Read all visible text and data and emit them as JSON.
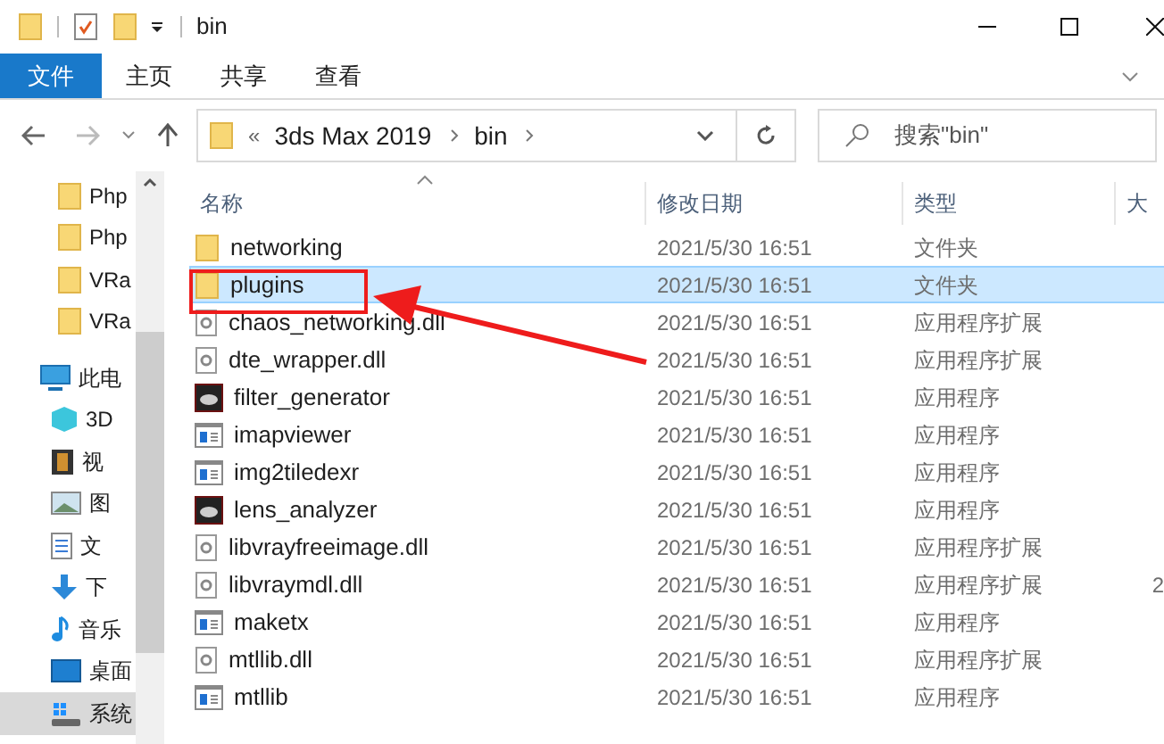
{
  "window": {
    "title": "bin"
  },
  "ribbon_tabs": [
    {
      "label": "文件",
      "selected": true
    },
    {
      "label": "主页",
      "selected": false
    },
    {
      "label": "共享",
      "selected": false
    },
    {
      "label": "查看",
      "selected": false
    }
  ],
  "address": {
    "overflow": "«",
    "path": [
      "3ds Max 2019",
      "bin"
    ]
  },
  "search": {
    "placeholder": "搜索\"bin\""
  },
  "sidebar": {
    "items": [
      {
        "label": "Php",
        "kind": "folder",
        "selected": false
      },
      {
        "label": "Php",
        "kind": "folder",
        "selected": false
      },
      {
        "label": "VRa",
        "kind": "folder",
        "selected": false
      },
      {
        "label": "VRa",
        "kind": "folder",
        "selected": false
      },
      {
        "label": "此电",
        "kind": "pc",
        "selected": false
      },
      {
        "label": "3D",
        "kind": "cube",
        "selected": false
      },
      {
        "label": "视",
        "kind": "video",
        "selected": false
      },
      {
        "label": "图",
        "kind": "image",
        "selected": false
      },
      {
        "label": "文",
        "kind": "document",
        "selected": false
      },
      {
        "label": "下",
        "kind": "download",
        "selected": false
      },
      {
        "label": "音乐",
        "kind": "music",
        "selected": false
      },
      {
        "label": "桌面",
        "kind": "desktop",
        "selected": false
      },
      {
        "label": "系统",
        "kind": "drive",
        "selected": true
      }
    ]
  },
  "table": {
    "columns": [
      "名称",
      "修改日期",
      "类型",
      "大"
    ],
    "rows": [
      {
        "name": "networking",
        "kind": "folder",
        "date": "2021/5/30 16:51",
        "type": "文件夹",
        "selected": false
      },
      {
        "name": "plugins",
        "kind": "folder",
        "date": "2021/5/30 16:51",
        "type": "文件夹",
        "selected": true
      },
      {
        "name": "chaos_networking.dll",
        "kind": "dll",
        "date": "2021/5/30 16:51",
        "type": "应用程序扩展",
        "selected": false
      },
      {
        "name": "dte_wrapper.dll",
        "kind": "dll",
        "date": "2021/5/30 16:51",
        "type": "应用程序扩展",
        "selected": false
      },
      {
        "name": "filter_generator",
        "kind": "dark-app",
        "date": "2021/5/30 16:51",
        "type": "应用程序",
        "selected": false
      },
      {
        "name": "imapviewer",
        "kind": "app",
        "date": "2021/5/30 16:51",
        "type": "应用程序",
        "selected": false
      },
      {
        "name": "img2tiledexr",
        "kind": "app",
        "date": "2021/5/30 16:51",
        "type": "应用程序",
        "selected": false
      },
      {
        "name": "lens_analyzer",
        "kind": "dark-app",
        "date": "2021/5/30 16:51",
        "type": "应用程序",
        "selected": false
      },
      {
        "name": "libvrayfreeimage.dll",
        "kind": "dll",
        "date": "2021/5/30 16:51",
        "type": "应用程序扩展",
        "selected": false
      },
      {
        "name": "libvraymdl.dll",
        "kind": "dll",
        "date": "2021/5/30 16:51",
        "type": "应用程序扩展",
        "size": "2",
        "selected": false
      },
      {
        "name": "maketx",
        "kind": "app",
        "date": "2021/5/30 16:51",
        "type": "应用程序",
        "selected": false
      },
      {
        "name": "mtllib.dll",
        "kind": "dll",
        "date": "2021/5/30 16:51",
        "type": "应用程序扩展",
        "selected": false
      },
      {
        "name": "mtllib",
        "kind": "app",
        "date": "2021/5/30 16:51",
        "type": "应用程序",
        "selected": false
      }
    ]
  }
}
